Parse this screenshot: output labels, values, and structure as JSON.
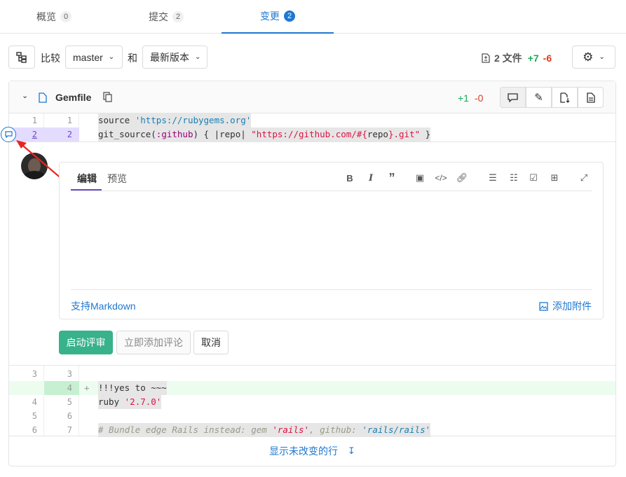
{
  "tabs": [
    {
      "label": "概览",
      "count": "0"
    },
    {
      "label": "提交",
      "count": "2"
    },
    {
      "label": "变更",
      "count": "2"
    }
  ],
  "compare": {
    "label": "比较",
    "source": "master",
    "and": "和",
    "target": "最新版本",
    "files_label": "2 文件",
    "added": "+7",
    "removed": "-6"
  },
  "file": {
    "name": "Gemfile",
    "added": "+1",
    "removed": "-0"
  },
  "diff_top": [
    {
      "old": "1",
      "new": "1",
      "code": "source 'https://rubygems.org'"
    },
    {
      "old": "2",
      "new": "2",
      "code": "git_source(:github) { |repo| \"https://github.com/#{repo}.git\" }"
    }
  ],
  "diff_bottom": [
    {
      "old": "3",
      "new": "3",
      "sign": "",
      "code": ""
    },
    {
      "old": "",
      "new": "4",
      "sign": "+",
      "code": "!!!yes to ~~~"
    },
    {
      "old": "4",
      "new": "5",
      "sign": "",
      "code": "ruby '2.7.0'"
    },
    {
      "old": "5",
      "new": "6",
      "sign": "",
      "code": ""
    },
    {
      "old": "6",
      "new": "7",
      "sign": "",
      "code": "# Bundle edge Rails instead: gem 'rails', github: 'rails/rails'"
    }
  ],
  "editor": {
    "tab_write": "编辑",
    "tab_preview": "预览",
    "markdown_link": "支持Markdown",
    "attach": "添加附件"
  },
  "actions": {
    "start_review": "启动评审",
    "add_now": "立即添加评论",
    "cancel": "取消"
  },
  "show_unchanged": "显示未改变的行",
  "colors": {
    "accent": "#1f78d1",
    "add_green": "#1aaa55",
    "remove_red": "#db3b21",
    "primary_btn": "#37b28a"
  }
}
